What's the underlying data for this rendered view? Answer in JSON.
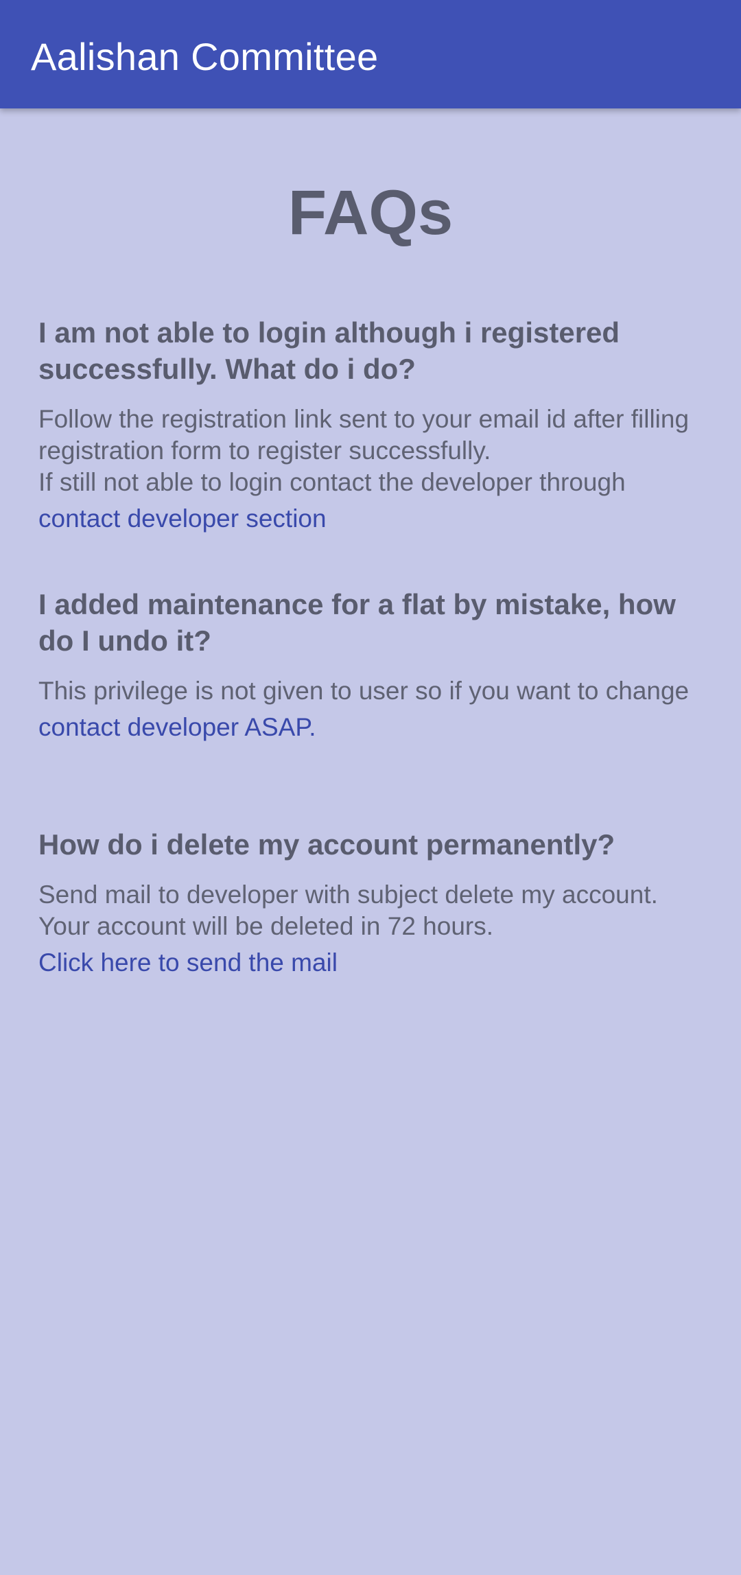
{
  "app_bar": {
    "title": "Aalishan Committee",
    "color": "#3f51b5"
  },
  "page": {
    "title": "FAQs",
    "background": "#c5c8e8"
  },
  "faqs": [
    {
      "question": "I am not able to login although i registered successfully. What do i do?",
      "answer_line1": "Follow the registration link sent to your email id after filling registration form to register successfully.",
      "answer_line2": "If still not able to login contact the developer through",
      "link": "contact developer section"
    },
    {
      "question": "I added maintenance for a flat by mistake, how do I undo it?",
      "answer_line1": "This privilege is not given to user so if you want to change",
      "link": "contact developer ASAP."
    },
    {
      "question": "How do i delete my account permanently?",
      "answer_line1": "Send mail to developer with subject delete my account. Your account will be deleted in 72 hours.",
      "link": "Click here to send the mail"
    }
  ],
  "colors": {
    "link": "#3949ab",
    "text": "#595c6e"
  }
}
